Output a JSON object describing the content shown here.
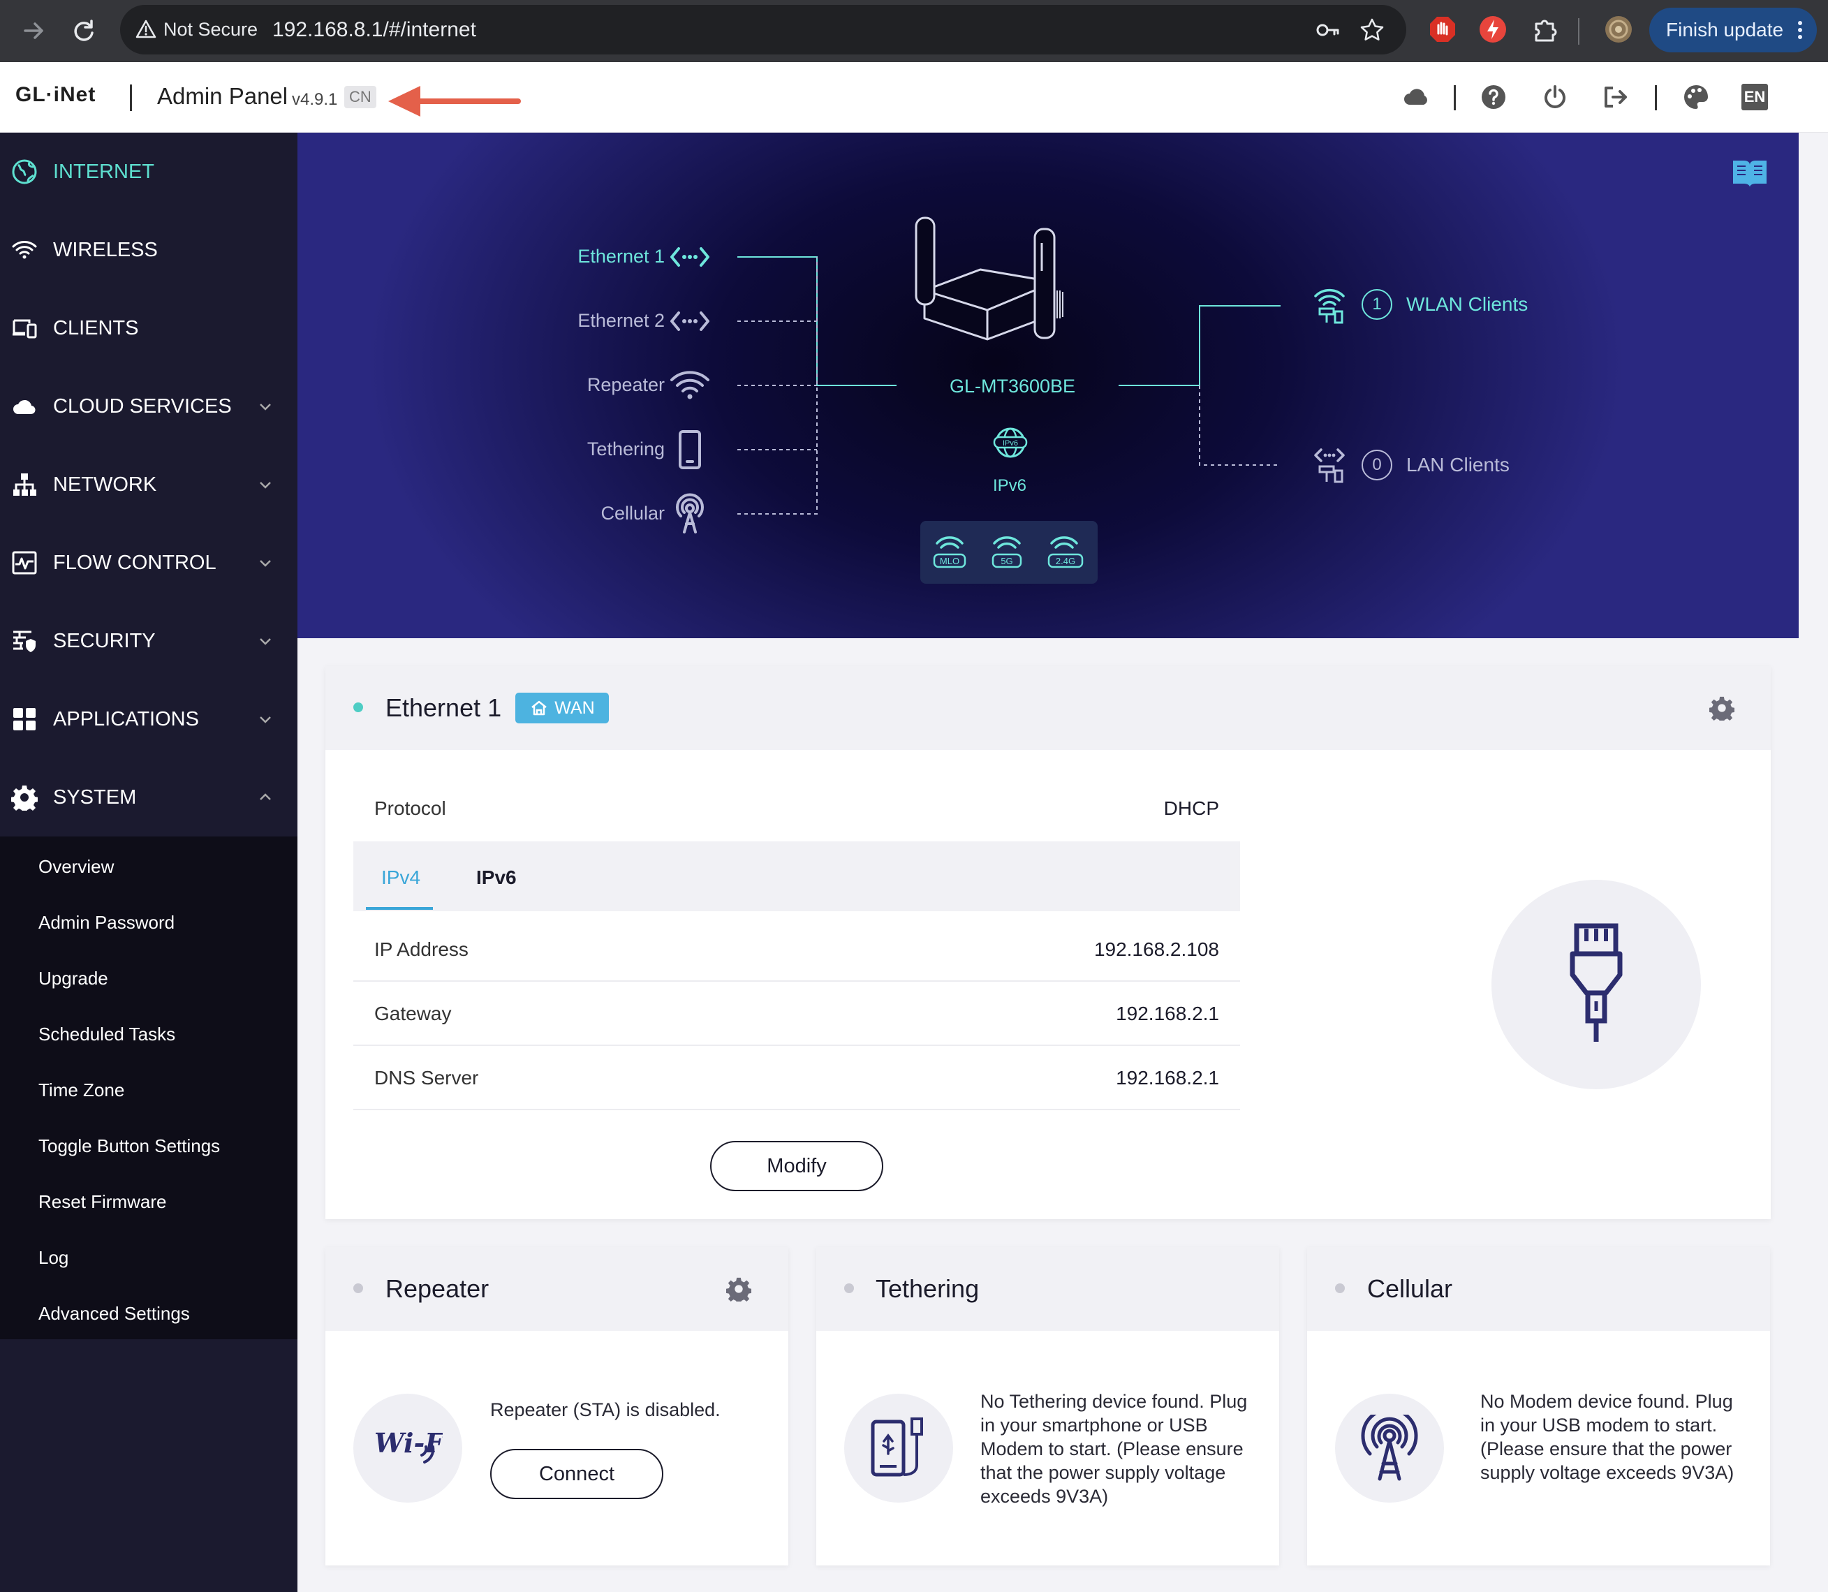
{
  "browser": {
    "security_label": "Not Secure",
    "url": "192.168.8.1/#/internet",
    "finish_update": "Finish update"
  },
  "header": {
    "logo": "GL·iNet",
    "title": "Admin Panel",
    "version": "v4.9.1",
    "region_badge": "CN",
    "language": "EN"
  },
  "sidebar": {
    "items": [
      {
        "label": "INTERNET",
        "icon": "globe-icon",
        "active": true
      },
      {
        "label": "WIRELESS",
        "icon": "wifi-icon"
      },
      {
        "label": "CLIENTS",
        "icon": "devices-icon"
      },
      {
        "label": "CLOUD SERVICES",
        "icon": "cloud-icon",
        "expand": "down"
      },
      {
        "label": "NETWORK",
        "icon": "network-icon",
        "expand": "down"
      },
      {
        "label": "FLOW CONTROL",
        "icon": "flow-icon",
        "expand": "down"
      },
      {
        "label": "SECURITY",
        "icon": "firewall-icon",
        "expand": "down"
      },
      {
        "label": "APPLICATIONS",
        "icon": "apps-icon",
        "expand": "down"
      },
      {
        "label": "SYSTEM",
        "icon": "gear-icon",
        "expand": "up"
      }
    ],
    "system_sub": [
      "Overview",
      "Admin Password",
      "Upgrade",
      "Scheduled Tasks",
      "Time Zone",
      "Toggle Button Settings",
      "Reset Firmware",
      "Log",
      "Advanced Settings"
    ]
  },
  "topology": {
    "interfaces": [
      "Ethernet 1",
      "Ethernet 2",
      "Repeater",
      "Tethering",
      "Cellular"
    ],
    "device": "GL-MT3600BE",
    "ipv6": "IPv6",
    "ipv6_badge": "IPv6",
    "bands": [
      "MLO",
      "5G",
      "2.4G"
    ],
    "wlan_clients": {
      "count": "1",
      "label": "WLAN Clients"
    },
    "lan_clients": {
      "count": "0",
      "label": "LAN Clients"
    }
  },
  "ethernet1": {
    "title": "Ethernet 1",
    "badge": "WAN",
    "protocol_label": "Protocol",
    "protocol_value": "DHCP",
    "tabs": [
      "IPv4",
      "IPv6"
    ],
    "rows": [
      {
        "label": "IP Address",
        "value": "192.168.2.108"
      },
      {
        "label": "Gateway",
        "value": "192.168.2.1"
      },
      {
        "label": "DNS Server",
        "value": "192.168.2.1"
      }
    ],
    "modify": "Modify"
  },
  "repeater": {
    "title": "Repeater",
    "message": "Repeater (STA) is disabled.",
    "connect": "Connect",
    "icon_text": "Wi-Fi"
  },
  "tethering": {
    "title": "Tethering",
    "message": "No Tethering device found. Plug in your smartphone or USB Modem to start. (Please ensure that the power supply voltage exceeds 9V3A)"
  },
  "cellular": {
    "title": "Cellular",
    "message": "No Modem device found. Plug in your USB modem to start.(Please ensure that the power supply voltage exceeds 9V3A)"
  },
  "colors": {
    "accent": "#5ee0d0",
    "sidebar_bg": "#1b1a2f",
    "wan_badge": "#4db3e0",
    "tab_active": "#3aa6d8",
    "status_dot_on": "#4ecdc4",
    "status_dot_off": "#c9c9d2"
  }
}
